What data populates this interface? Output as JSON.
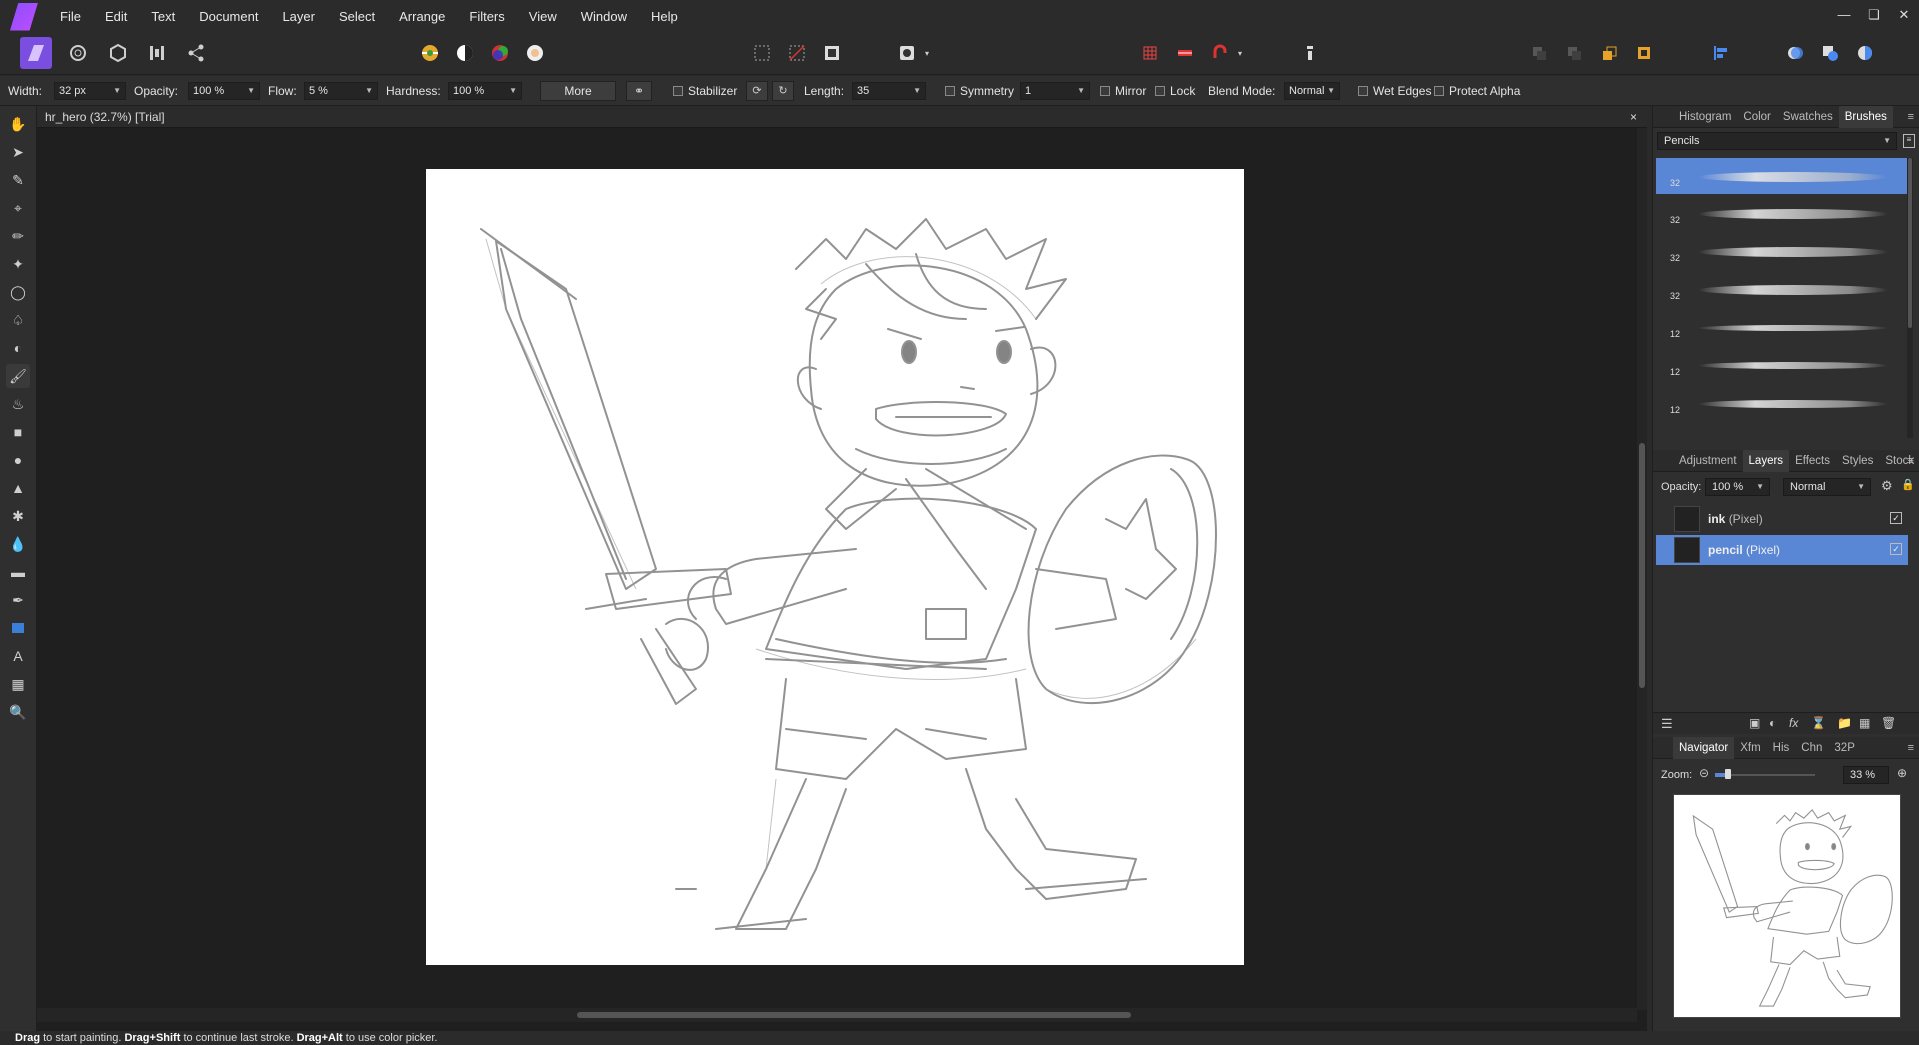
{
  "app": {
    "title": "Affinity Photo"
  },
  "menubar": {
    "items": [
      "File",
      "Edit",
      "Text",
      "Document",
      "Layer",
      "Select",
      "Arrange",
      "Filters",
      "View",
      "Window",
      "Help"
    ],
    "window_controls": [
      "minimize",
      "restore",
      "close"
    ]
  },
  "context_toolbar": {
    "width_label": "Width:",
    "width_value": "32 px",
    "opacity_label": "Opacity:",
    "opacity_value": "100 %",
    "flow_label": "Flow:",
    "flow_value": "5 %",
    "hardness_label": "Hardness:",
    "hardness_value": "100 %",
    "more_label": "More",
    "stabilizer_label": "Stabilizer",
    "length_label": "Length:",
    "length_value": "35",
    "symmetry_label": "Symmetry",
    "symmetry_value": "1",
    "mirror_label": "Mirror",
    "lock_label": "Lock",
    "blend_mode_label": "Blend Mode:",
    "blend_mode_value": "Normal",
    "wet_edges_label": "Wet Edges",
    "protect_alpha_label": "Protect Alpha"
  },
  "document": {
    "tab_title": "hr_hero (32.7%) [Trial]",
    "close": "×"
  },
  "brushes_panel": {
    "tabs": [
      "Histogram",
      "Color",
      "Swatches",
      "Brushes"
    ],
    "active_tab": "Brushes",
    "category": "Pencils",
    "brushes": [
      {
        "size": "32",
        "selected": true
      },
      {
        "size": "32",
        "selected": false
      },
      {
        "size": "32",
        "selected": false
      },
      {
        "size": "32",
        "selected": false
      },
      {
        "size": "12",
        "selected": false
      },
      {
        "size": "12",
        "selected": false
      },
      {
        "size": "12",
        "selected": false
      }
    ]
  },
  "layers_panel": {
    "tabs": [
      "Adjustment",
      "Layers",
      "Effects",
      "Styles",
      "Stock"
    ],
    "active_tab": "Layers",
    "opacity_label": "Opacity:",
    "opacity_value": "100 %",
    "blend_value": "Normal",
    "layers": [
      {
        "name": "ink",
        "type": "(Pixel)",
        "visible": true,
        "selected": false
      },
      {
        "name": "pencil",
        "type": "(Pixel)",
        "visible": true,
        "selected": true
      }
    ]
  },
  "navigator_panel": {
    "tabs": [
      "Navigator",
      "Xfm",
      "His",
      "Chn",
      "32P"
    ],
    "active_tab": "Navigator",
    "zoom_label": "Zoom:",
    "zoom_value": "33 %"
  },
  "status_bar": {
    "parts": [
      {
        "bold": "Drag",
        "text": " to start painting. "
      },
      {
        "bold": "Drag+Shift",
        "text": " to continue last stroke. "
      },
      {
        "bold": "Drag+Alt",
        "text": " to use color picker."
      }
    ]
  }
}
